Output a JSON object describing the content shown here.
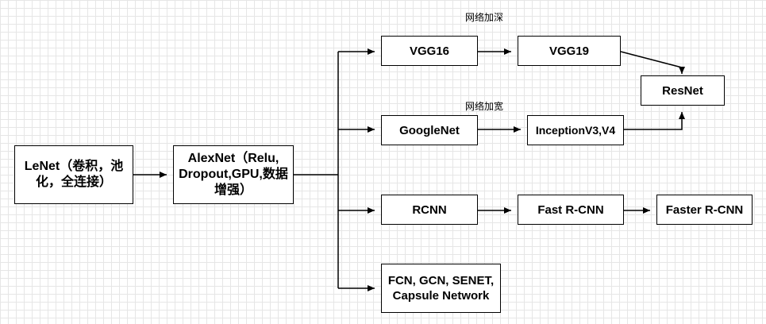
{
  "nodes": {
    "lenet": "LeNet（卷积，池化，全连接）",
    "alexnet": "AlexNet（Relu, Dropout,GPU,数据增强）",
    "vgg16": "VGG16",
    "vgg19": "VGG19",
    "resnet": "ResNet",
    "googlenet": "GoogleNet",
    "inception": "InceptionV3,V4",
    "rcnn": "RCNN",
    "fast_rcnn": "Fast R-CNN",
    "faster_rcnn": "Faster R-CNN",
    "others": "FCN, GCN, SENET, Capsule Network"
  },
  "notes": {
    "deeper": "网络加深",
    "wider": "网络加宽"
  }
}
